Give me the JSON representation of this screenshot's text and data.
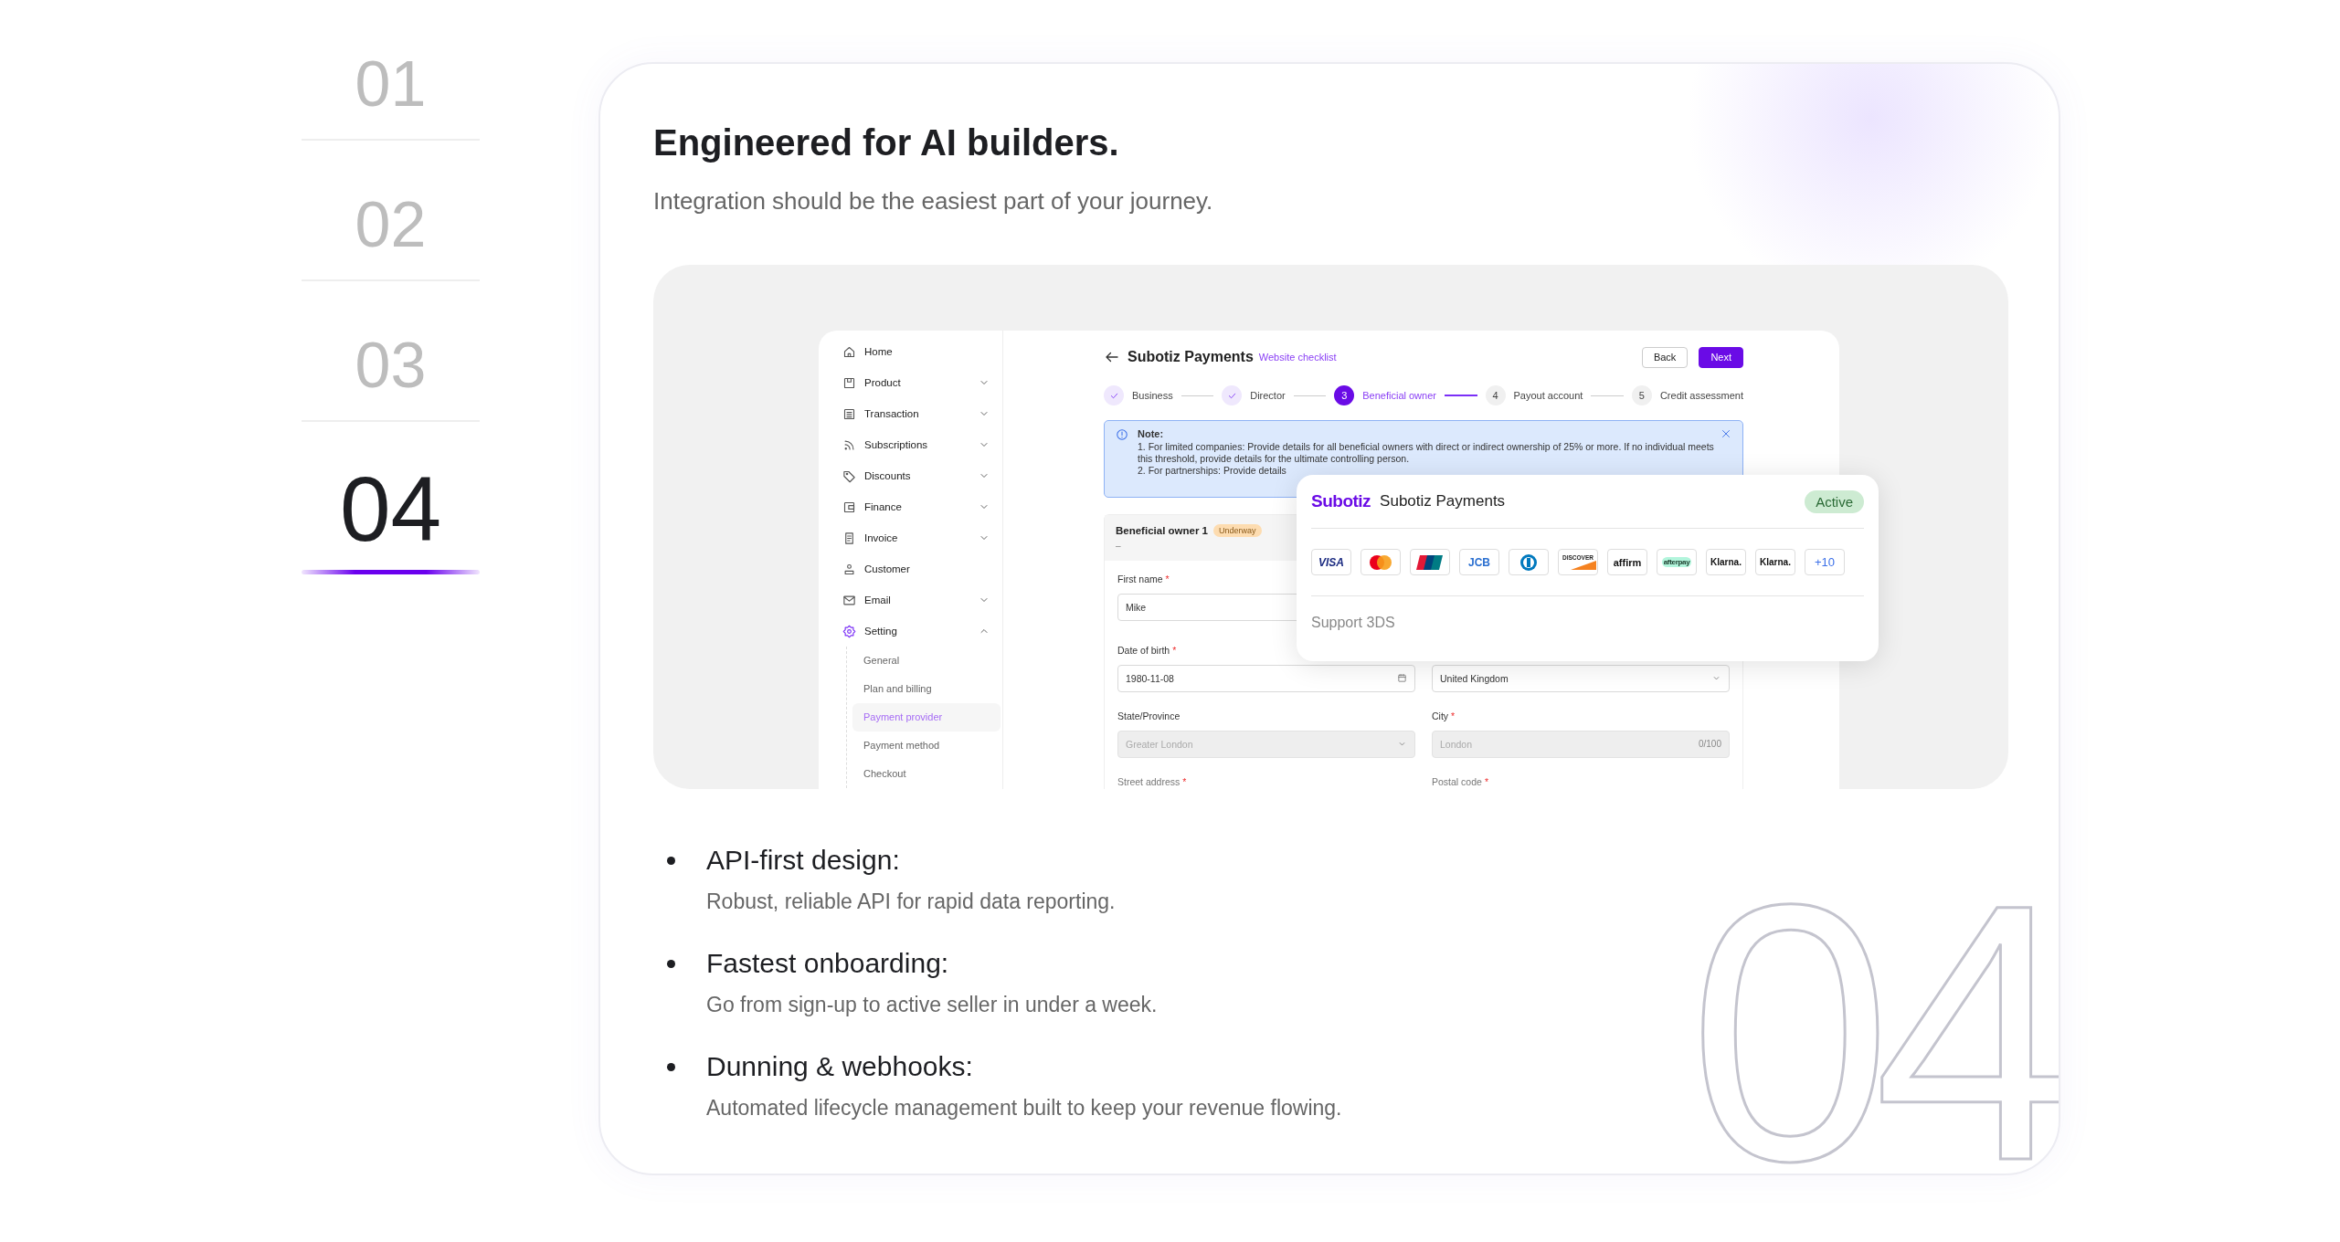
{
  "section_nav": [
    {
      "label": "01",
      "selected": false
    },
    {
      "label": "02",
      "selected": false
    },
    {
      "label": "03",
      "selected": false
    },
    {
      "label": "04",
      "selected": true
    }
  ],
  "card": {
    "title": "Engineered for AI builders.",
    "subtitle": "Integration should be the easiest part of your journey.",
    "background_number": "04"
  },
  "app": {
    "sidebar": [
      {
        "label": "Home",
        "selected": false
      },
      {
        "label": "Product",
        "selected": false,
        "expanded": false
      },
      {
        "label": "Transaction",
        "selected": false,
        "expanded": false
      },
      {
        "label": "Subscriptions",
        "selected": false,
        "expanded": false
      },
      {
        "label": "Discounts",
        "selected": false,
        "expanded": false
      },
      {
        "label": "Finance",
        "selected": false,
        "expanded": false
      },
      {
        "label": "Invoice",
        "selected": false,
        "expanded": false
      },
      {
        "label": "Customer",
        "selected": false
      },
      {
        "label": "Email",
        "selected": false,
        "expanded": false
      },
      {
        "label": "Setting",
        "selected": true,
        "expanded": true,
        "children": [
          {
            "label": "General",
            "selected": false
          },
          {
            "label": "Plan and billing",
            "selected": false
          },
          {
            "label": "Payment provider",
            "selected": true
          },
          {
            "label": "Payment method",
            "selected": false
          },
          {
            "label": "Checkout",
            "selected": false
          }
        ]
      }
    ],
    "header": {
      "title": "Subotiz Payments",
      "link": "Website checklist",
      "buttons": [
        {
          "label": "Back",
          "kind": "secondary"
        },
        {
          "label": "Next",
          "kind": "primary"
        }
      ]
    },
    "steps": [
      {
        "label": "Business",
        "done": true,
        "current": false
      },
      {
        "label": "Director",
        "done": true,
        "current": false
      },
      {
        "number": "3",
        "label": "Beneficial owner",
        "done": false,
        "current": true
      },
      {
        "number": "4",
        "label": "Payout account",
        "done": false,
        "current": false
      },
      {
        "number": "5",
        "label": "Credit assessment",
        "done": false,
        "current": false
      }
    ],
    "note": {
      "title": "Note:",
      "lines": [
        "1. For limited companies: Provide details for all beneficial owners with direct or indirect ownership of 25% or more. If no individual meets this threshold, provide details for the ultimate controlling person.",
        "2. For partnerships: Provide details"
      ]
    },
    "form": {
      "title": "Beneficial owner 1",
      "badge": "Underway",
      "subtitle": "–",
      "rows": [
        [
          {
            "label": "First name",
            "required_mark": "*",
            "kind": "text",
            "value": "Mike",
            "disabled": false
          }
        ],
        [
          {
            "label": "Date of birth",
            "required_mark": "*",
            "kind": "date",
            "value": "1980-11-08",
            "disabled": false
          },
          {
            "kind": "select",
            "value": "United Kingdom",
            "disabled": false
          }
        ],
        [
          {
            "label": "State/Province",
            "kind": "select",
            "placeholder": "Greater London",
            "disabled": true
          },
          {
            "label": "City",
            "required_mark": "*",
            "kind": "text",
            "placeholder": "London",
            "counter": "0/100",
            "disabled": true
          }
        ],
        [
          {
            "label": "Street address",
            "required_mark": "*"
          },
          {
            "label": "Postal code",
            "required_mark": "*"
          }
        ]
      ]
    }
  },
  "provider_popup": {
    "logo": "Subotiz",
    "name": "Subotiz Payments",
    "status": "Active",
    "payment_methods": [
      {
        "kind": "visa",
        "label": "VISA"
      },
      {
        "kind": "mastercard"
      },
      {
        "kind": "unionpay"
      },
      {
        "kind": "jcb",
        "label": "JCB"
      },
      {
        "kind": "diners"
      },
      {
        "kind": "discover",
        "label": "DISCOVER"
      },
      {
        "kind": "affirm",
        "label": "affirm"
      },
      {
        "kind": "afterpay",
        "label": "afterpay"
      },
      {
        "kind": "klarna",
        "label": "Klarna."
      },
      {
        "kind": "klarna",
        "label": "Klarna."
      },
      {
        "kind": "more",
        "label": "+10"
      }
    ],
    "footer": "Support 3DS"
  },
  "features": [
    {
      "title": "API-first design:",
      "text": "Robust, reliable API for rapid data reporting."
    },
    {
      "title": "Fastest onboarding:",
      "text": "Go from sign-up to active seller in under a week."
    },
    {
      "title": "Dunning & webhooks:",
      "text": "Automated lifecycle management built to keep your revenue flowing."
    }
  ]
}
